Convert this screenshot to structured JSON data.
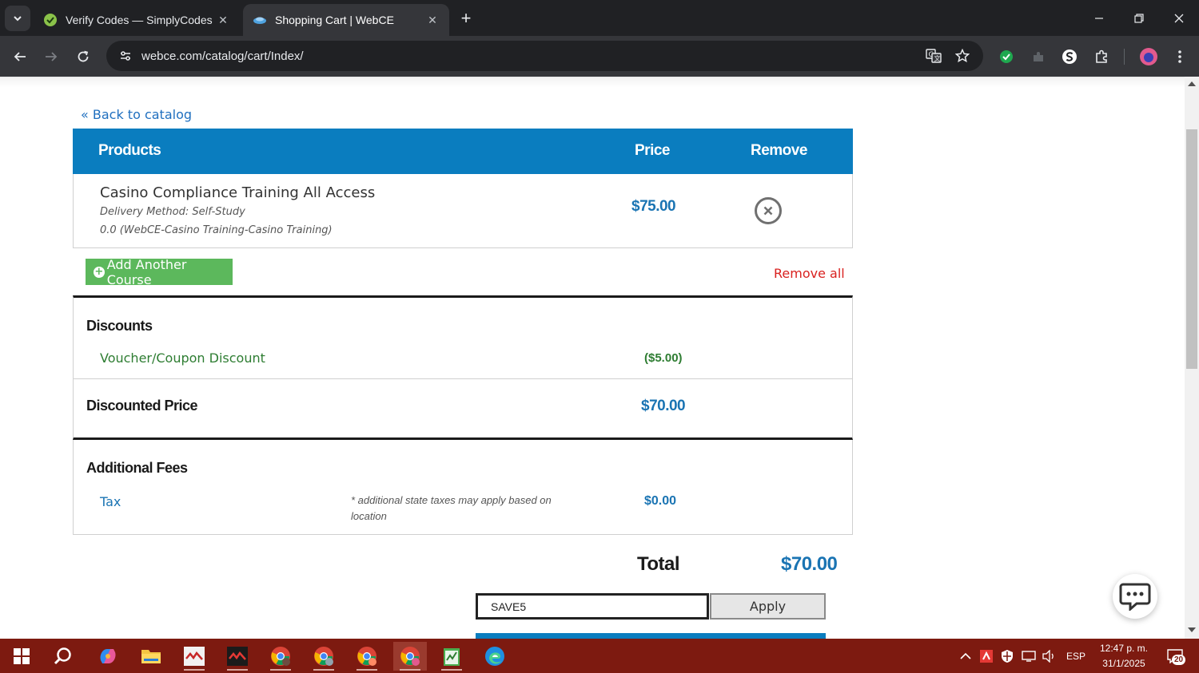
{
  "browser": {
    "tabs": [
      {
        "title": "Verify Codes — SimplyCodes",
        "active": false
      },
      {
        "title": "Shopping Cart | WebCE",
        "active": true
      }
    ],
    "url": "webce.com/catalog/cart/Index/"
  },
  "page": {
    "back_link": "« Back to catalog",
    "cart_headers": {
      "products": "Products",
      "price": "Price",
      "remove": "Remove"
    },
    "item": {
      "name": "Casino Compliance Training All Access",
      "delivery": "Delivery Method: Self-Study",
      "detail": "0.0 (WebCE-Casino Training-Casino Training)",
      "price": "$75.00"
    },
    "add_course_label": "Add Another Course",
    "remove_all_label": "Remove all",
    "discounts": {
      "title": "Discounts",
      "label": "Voucher/Coupon Discount",
      "value": "($5.00)"
    },
    "discounted_price": {
      "label": "Discounted Price",
      "value": "$70.00"
    },
    "fees": {
      "title": "Additional Fees",
      "tax_label": "Tax",
      "tax_note": "* additional state taxes may apply based on location",
      "tax_value": "$0.00"
    },
    "total": {
      "label": "Total",
      "value": "$70.00"
    },
    "coupon": {
      "value": "SAVE5",
      "apply_label": "Apply"
    }
  },
  "taskbar": {
    "language": "ESP",
    "time": "12:47 p. m.",
    "date": "31/1/2025",
    "notifications": "20"
  },
  "colors": {
    "header_blue": "#0a7dbf",
    "price_blue": "#1a74b3",
    "discount_green": "#2e7d32",
    "add_button_green": "#5cb85c",
    "remove_all_red": "#d9211f",
    "taskbar": "#7d1a10"
  }
}
